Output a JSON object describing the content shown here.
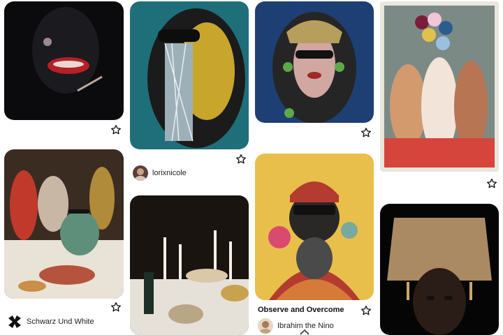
{
  "feed": {
    "pins": [
      {
        "id": "pin-1",
        "image_alt": "masked red lips"
      },
      {
        "id": "pin-2",
        "image_alt": "sequin sunglasses"
      },
      {
        "id": "pin-3",
        "image_alt": "gold headpiece"
      },
      {
        "id": "pin-4",
        "image_alt": "balloon party"
      },
      {
        "id": "pin-5",
        "image_alt": "dinner table group"
      },
      {
        "id": "pin-6",
        "image_alt": "candle lit dinner"
      },
      {
        "id": "pin-7",
        "image_alt": "illustrated portrait",
        "title": "Observe and Overcome"
      },
      {
        "id": "pin-8",
        "image_alt": "fur hat portrait"
      }
    ],
    "authors": {
      "lorixnicole": "lorixnicole",
      "schwarz": "Schwarz Und White",
      "ibrahim": "Ibrahim the Nino"
    }
  },
  "icons": {
    "save": "star-icon",
    "scroll": "chevron-up-icon"
  },
  "colors": {
    "text": "#111111",
    "muted": "#222222",
    "background": "#ffffff"
  }
}
